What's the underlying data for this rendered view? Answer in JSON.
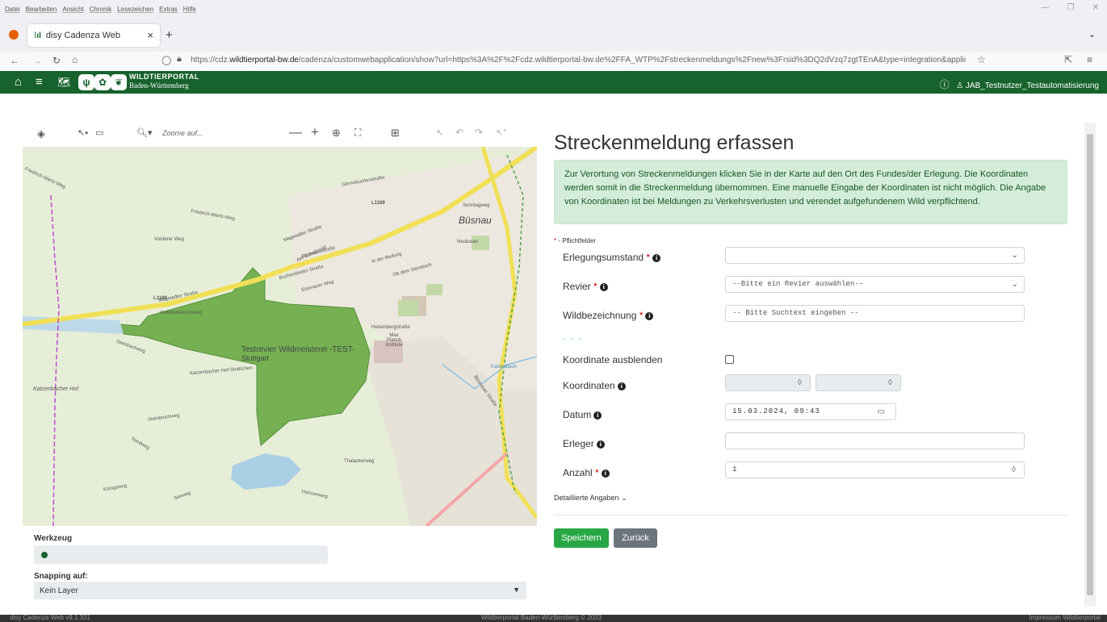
{
  "browser": {
    "menu": [
      "Datei",
      "Bearbeiten",
      "Ansicht",
      "Chronik",
      "Lesezeichen",
      "Extras",
      "Hilfe"
    ],
    "tab_title": "disy Cadenza Web",
    "url_prefix": "https://cdz.",
    "url_host": "wildtierportal-bw.de",
    "url_rest": "/cadenza/customwebapplication/show?url=https%3A%2F%2Fcdz.wildtierportal-bw.de%2FFA_WTP%2Fstreckenmeldungs%2Fnew%3Frsid%3DQ2dVzq7zgtTEnA&type=integration&applicationId"
  },
  "header": {
    "portal_line1": "WILDTIERPORTAL",
    "portal_line2": "Baden-Württemberg",
    "user": "JAB_Testnutzer_Testautomatisierung"
  },
  "map": {
    "search_placeholder": "Zoome auf...",
    "labels": {
      "busnau": "Büsnau",
      "revier": "Testrevier Wildmeisterei -TEST-",
      "stuttgart": "Stuttgart",
      "katzenbacher_hof": "Katzenbacher Hof",
      "magstadter": "Magstadter Straße",
      "friedrich": "Friedrich-Wertz-Weg",
      "vorderer": "Vorderer Weg",
      "hummelwiesen": "Hummelwiesenweg",
      "steinbach": "Steinbachweg",
      "katzenbacher_hof_str": "Katzenbacher Hof-Sträßchen",
      "steinbruch": "Steinbruchweg",
      "sandweg": "Sandweg",
      "thalacker": "Thalackerweg",
      "heinzenweg": "Heinzenweg",
      "konigsweg": "Königsweg",
      "seeweg": "Seeweg",
      "l1189": "L1189",
      "l1189b": "L1189",
      "am_schattwald": "Am Schattwald",
      "barensee": "Bärenseestraße",
      "buchenlander": "Buchenländer Straße",
      "eisenauer": "Eisenauer Weg",
      "rodung": "In der Rodung",
      "steinbach2": "Ob dem Steinbach",
      "heisenberg": "Heisenbergstraße",
      "maxplanck": "Max Planck Institute",
      "sonntagweg": "Sonntagweg",
      "neubauer": "Neubauer",
      "katzenbach": "Katzenbach",
      "bussnauer": "Büsnauer Straße",
      "glemsbuch": "Glemsbuchenstraße"
    }
  },
  "werkzeug": {
    "label": "Werkzeug"
  },
  "snapping": {
    "label": "Snapping auf:",
    "value": "Kein Layer"
  },
  "form": {
    "title": "Streckenmeldung erfassen",
    "info": "Zur Verortung von Streckenmeldungen klicken Sie in der Karte auf den Ort des Fundes/der Erlegung. Die Koordinaten werden somit in die Streckenmeldung übernommen. Eine manuelle Eingabe der Koordinaten ist nicht möglich. Die Angabe von Koordinaten ist bei Meldungen zu Verkehrsverlusten und verendet aufgefundenem Wild verpflichtend.",
    "required_note": " - Pflichtfelder",
    "fields": {
      "erlegungsumstand": {
        "label": "Erlegungsumstand",
        "value": ""
      },
      "revier": {
        "label": "Revier",
        "value": "--Bitte ein Revier auswählen--"
      },
      "wild": {
        "label": "Wildbezeichnung",
        "placeholder": "-- Bitte Suchtext eingeben --"
      },
      "hide_coord": {
        "label": "Koordinate ausblenden"
      },
      "coords": {
        "label": "Koordinaten"
      },
      "datum": {
        "label": "Datum",
        "value": "15.03.2024, 09:43"
      },
      "erleger": {
        "label": "Erleger",
        "value": ""
      },
      "anzahl": {
        "label": "Anzahl",
        "value": "1"
      }
    },
    "dashes": "- - -",
    "detail_link": "Detaillierte Angaben",
    "save": "Speichern",
    "back": "Zurück"
  },
  "footer": {
    "left": "disy Cadenza Web v9.1.331",
    "center": "Wildtierportal Baden-Württemberg © 2023",
    "right": "Impressum Wildtierportal"
  },
  "colors": {
    "brand": "#17622d",
    "forest": "#6fae4b",
    "save": "#28a745",
    "back": "#6c757d"
  }
}
